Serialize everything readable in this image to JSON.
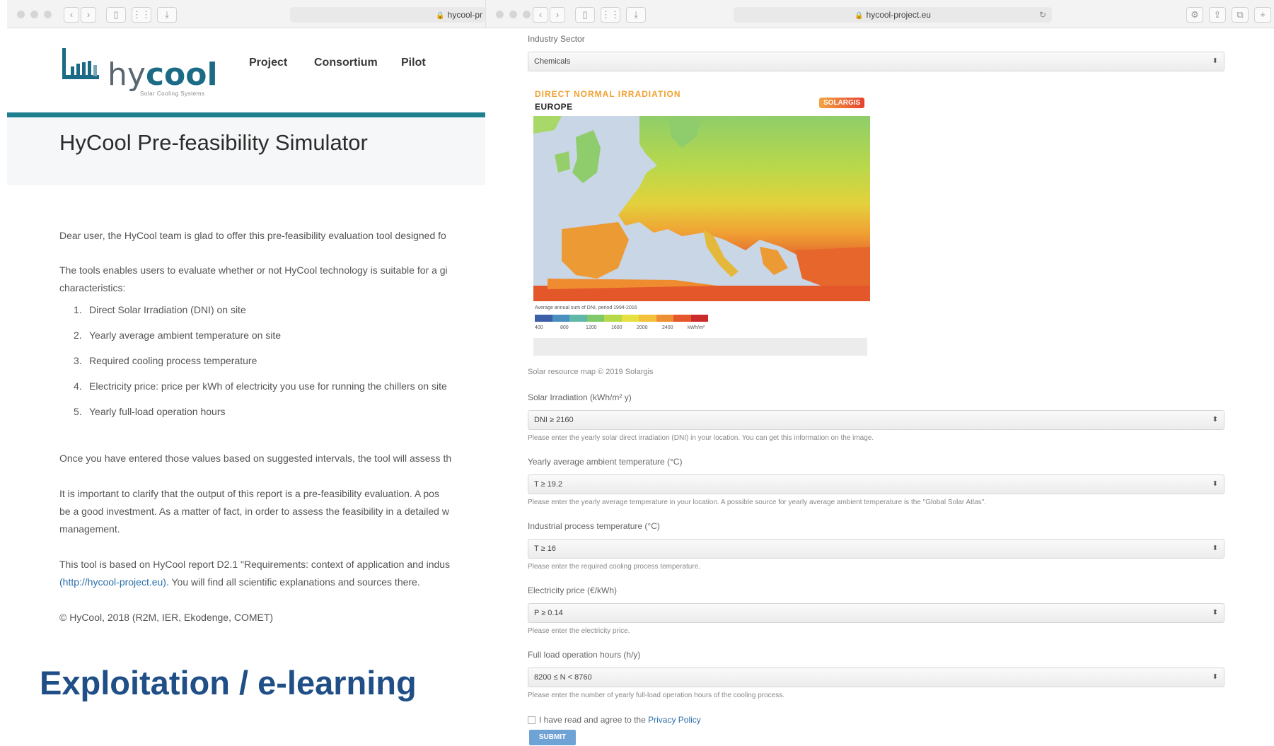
{
  "left_window": {
    "address": "hycool-pr",
    "logo": {
      "name_prefix": "hy",
      "name_bold": "cool",
      "tagline": "Solar Cooling Systems"
    },
    "nav": [
      "Project",
      "Consortium",
      "Pilot"
    ],
    "page_title": "HyCool Pre-feasibility Simulator",
    "intro": "Dear user, the HyCool team is glad to offer this pre-feasibility evaluation tool designed fo",
    "tools_line1": "The tools enables users to evaluate whether or not HyCool technology is suitable for a gi",
    "tools_line2": "characteristics:",
    "list": [
      {
        "n": "1.",
        "text": "Direct Solar Irradiation (DNI) on site"
      },
      {
        "n": "2.",
        "text": "Yearly average ambient temperature on site"
      },
      {
        "n": "3.",
        "text": "Required cooling process temperature"
      },
      {
        "n": "4.",
        "text": "Electricity price: price per kWh of electricity you use for running the chillers on site"
      },
      {
        "n": "5.",
        "text": "Yearly full-load operation hours"
      }
    ],
    "once": "Once you have entered those values based on suggested intervals, the tool will assess th",
    "important1": "It is important to clarify that the output of this report is a pre-feasibility evaluation. A pos",
    "important2": "be a good investment. As a matter of fact, in order to assess the feasibility in a detailed w",
    "important3": "management.",
    "based1": "This tool is based on HyCool report D2.1 \"Requirements: context of application and indus",
    "based2_link": "(http://hycool-project.eu)",
    "based2_rest": ". You will find all scientific explanations and sources there.",
    "copyright": "© HyCool, 2018 (R2M, IER, Ekodenge, COMET)"
  },
  "slide_caption": "Exploitation / e-learning",
  "right_window": {
    "address": "hycool-project.eu",
    "industry_label": "Industry Sector",
    "industry_value": "Chemicals",
    "map": {
      "title1": "DIRECT NORMAL IRRADIATION",
      "title2": "EUROPE",
      "badge": "SOLARGIS",
      "legend_caption": "Average annual sum of DNI, period 1994-2016",
      "legend_ticks": [
        "400",
        "800",
        "1200",
        "1600",
        "2000",
        "2400"
      ],
      "legend_unit": "kWh/m²",
      "legend_colors": [
        "#3c5fa8",
        "#4a8fc0",
        "#5fb8a8",
        "#7fc96a",
        "#b6d94a",
        "#e6e040",
        "#f3c13a",
        "#ef8f33",
        "#e5572c",
        "#cc2b2b"
      ]
    },
    "map_credit": "Solar resource map © 2019 Solargis",
    "fields": [
      {
        "label": "Solar Irradiation (kWh/m² y)",
        "value": "DNI ≥ 2160",
        "help": "Please enter the yearly solar direct irradiation (DNI) in your location. You can get this information on the image."
      },
      {
        "label": "Yearly average ambient temperature (°C)",
        "value": "T ≥ 19.2",
        "help": "Please enter the yearly average temperature in your location. A possible source for yearly average ambient temperature is the \"Global Solar Atlas\"."
      },
      {
        "label": "Industrial process temperature (°C)",
        "value": "T ≥ 16",
        "help": "Please enter the required cooling process temperature."
      },
      {
        "label": "Electricity price (€/kWh)",
        "value": "P ≥ 0.14",
        "help": "Please enter the electricity price."
      },
      {
        "label": "Full load operation hours (h/y)",
        "value": "8200 ≤ N < 8760",
        "help": "Please enter the number of yearly full-load operation hours of the cooling process."
      }
    ],
    "agree_text": "I have read and agree to the ",
    "privacy_link": "Privacy Policy",
    "submit_label": "SUBMIT"
  },
  "colors": {
    "teal_rule": "#1e7f8f",
    "caption_blue": "#1f4f86",
    "link_blue": "#2a6ea8"
  }
}
